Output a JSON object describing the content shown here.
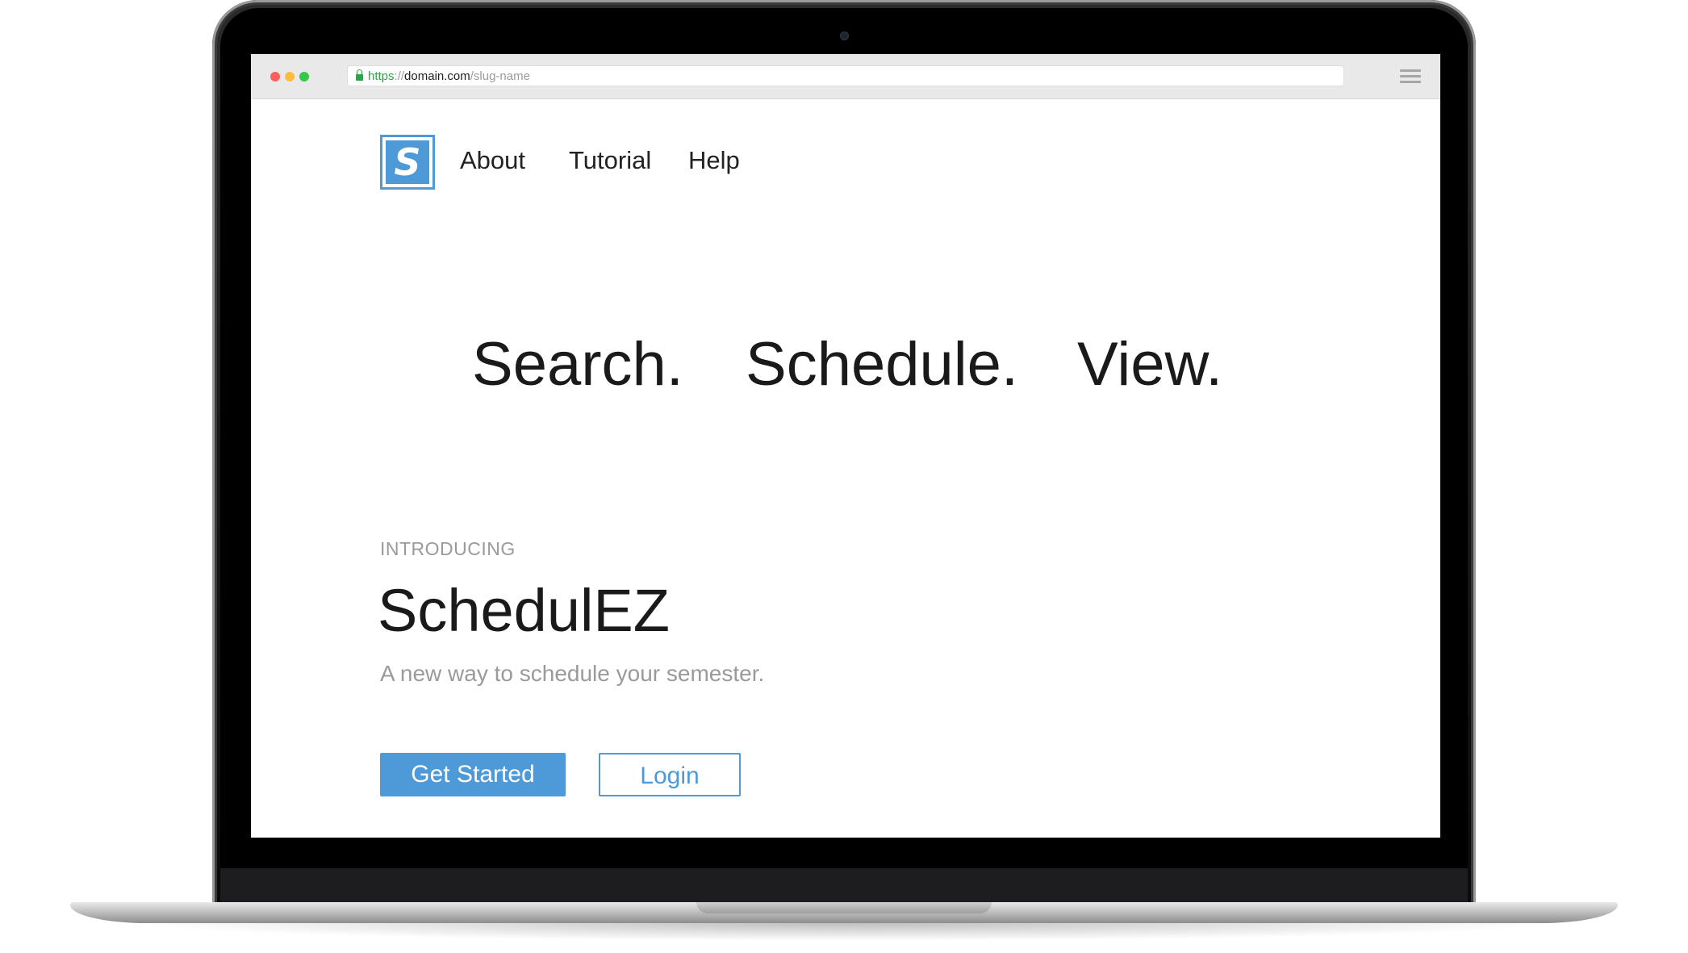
{
  "browser": {
    "url_scheme": "https",
    "url_sep": "://",
    "url_host": "domain.com",
    "url_path": "/slug-name",
    "lock_icon": "lock-icon",
    "menu_icon": "hamburger-menu-icon"
  },
  "header": {
    "logo_letter": "S",
    "nav": [
      {
        "label": "About"
      },
      {
        "label": "Tutorial"
      },
      {
        "label": "Help"
      }
    ]
  },
  "hero": {
    "taglines": [
      "Search.",
      "Schedule.",
      "View."
    ]
  },
  "intro": {
    "eyebrow": "INTRODUCING",
    "title": "SchedulEZ",
    "subtitle": "A new way to schedule your semester."
  },
  "actions": {
    "primary_label": "Get Started",
    "secondary_label": "Login"
  },
  "colors": {
    "accent": "#4e9ad8",
    "text": "#1a1a1a",
    "muted": "#9a9a9a",
    "secure": "#28a745"
  }
}
